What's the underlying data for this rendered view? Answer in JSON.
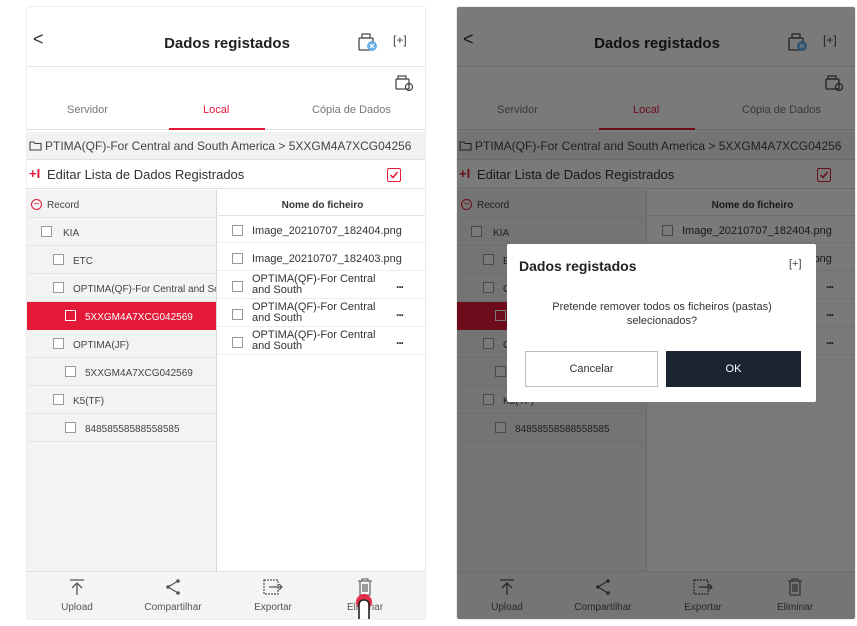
{
  "header": {
    "back_symbol": "<",
    "title": "Dados registados",
    "expand_symbol": "[+]"
  },
  "tabs": [
    {
      "label": "Servidor"
    },
    {
      "label": "Local"
    },
    {
      "label": "Cópia de Dados"
    }
  ],
  "path": {
    "text": "PTIMA(QF)-For Central and South America > 5XXGM4A7XCG04256"
  },
  "edit_bar": {
    "icon_symbol": "+I",
    "label": "Editar Lista de Dados Registrados"
  },
  "tree": {
    "record_symbol": "−",
    "items": [
      {
        "label": "Record"
      },
      {
        "label": "KIA"
      },
      {
        "label": "ETC"
      },
      {
        "label": "OPTIMA(QF)-For Central and So"
      },
      {
        "label": "5XXGM4A7XCG042569"
      },
      {
        "label": "OPTIMA(JF)"
      },
      {
        "label": "5XXGM4A7XCG042569"
      },
      {
        "label": "K5(TF)"
      },
      {
        "label": "84858558588558585"
      }
    ]
  },
  "files": {
    "header": "Nome do ficheiro",
    "more_symbol": "...",
    "items": [
      {
        "name": "Image_20210707_182404.png"
      },
      {
        "name": "Image_20210707_182403.png"
      },
      {
        "name": "OPTIMA(QF)-For Central and South"
      },
      {
        "name": "OPTIMA(QF)-For Central and South"
      },
      {
        "name": "OPTIMA(QF)-For Central and South"
      }
    ]
  },
  "bottom_bar": [
    {
      "label": "Upload",
      "icon": "upload-icon"
    },
    {
      "label": "Compartilhar",
      "icon": "share-icon"
    },
    {
      "label": "Exportar",
      "icon": "export-icon"
    },
    {
      "label": "Eliminar",
      "icon": "trash-icon"
    }
  ],
  "dialog": {
    "title": "Dados registados",
    "expand_symbol": "[+]",
    "message": "Pretende remover todos os ficheiros (pastas) selecionados?",
    "cancel": "Cancelar",
    "ok": "OK"
  },
  "colors": {
    "accent": "#e31937",
    "dark_button": "#1b2531",
    "tree_bg": "#f3f3f3"
  }
}
